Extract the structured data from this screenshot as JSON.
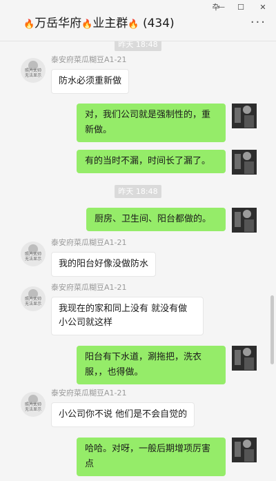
{
  "header": {
    "title_part1": "万岳华府",
    "title_part2": "业主群",
    "member_count": "(434)",
    "fire_icon": "🔥",
    "controls": {
      "pin": "卆",
      "minimize": "—",
      "maximize": "☐",
      "close": "✕"
    },
    "more": "···"
  },
  "avatar_placeholder": "照片太帅\n无法显示",
  "messages": {
    "time_top": "昨天 18:48",
    "m1_sender": "泰安府菜瓜糊豆A1-21",
    "m1_text": "防水必须重新做",
    "m2_text": "对，我们公司就是强制性的，重新做。",
    "m3_text": "有的当时不漏，时间长了漏了。",
    "time2": "昨天 18:48",
    "m4_text": "厨房、卫生间、阳台都做的。",
    "m5_sender": "泰安府菜瓜糊豆A1-21",
    "m5_text": "我的阳台好像没做防水",
    "m6_sender": "泰安府菜瓜糊豆A1-21",
    "m6_text": "我现在的家和同上没有 就没有做 小公司就这样",
    "m7_text": "阳台有下水道，涮拖把，洗衣服，，也得做。",
    "m8_sender": "泰安府菜瓜糊豆A1-21",
    "m8_text": "小公司你不说 他们是不会自觉的",
    "m9_text": "哈哈。对呀，一般后期增项厉害点"
  }
}
